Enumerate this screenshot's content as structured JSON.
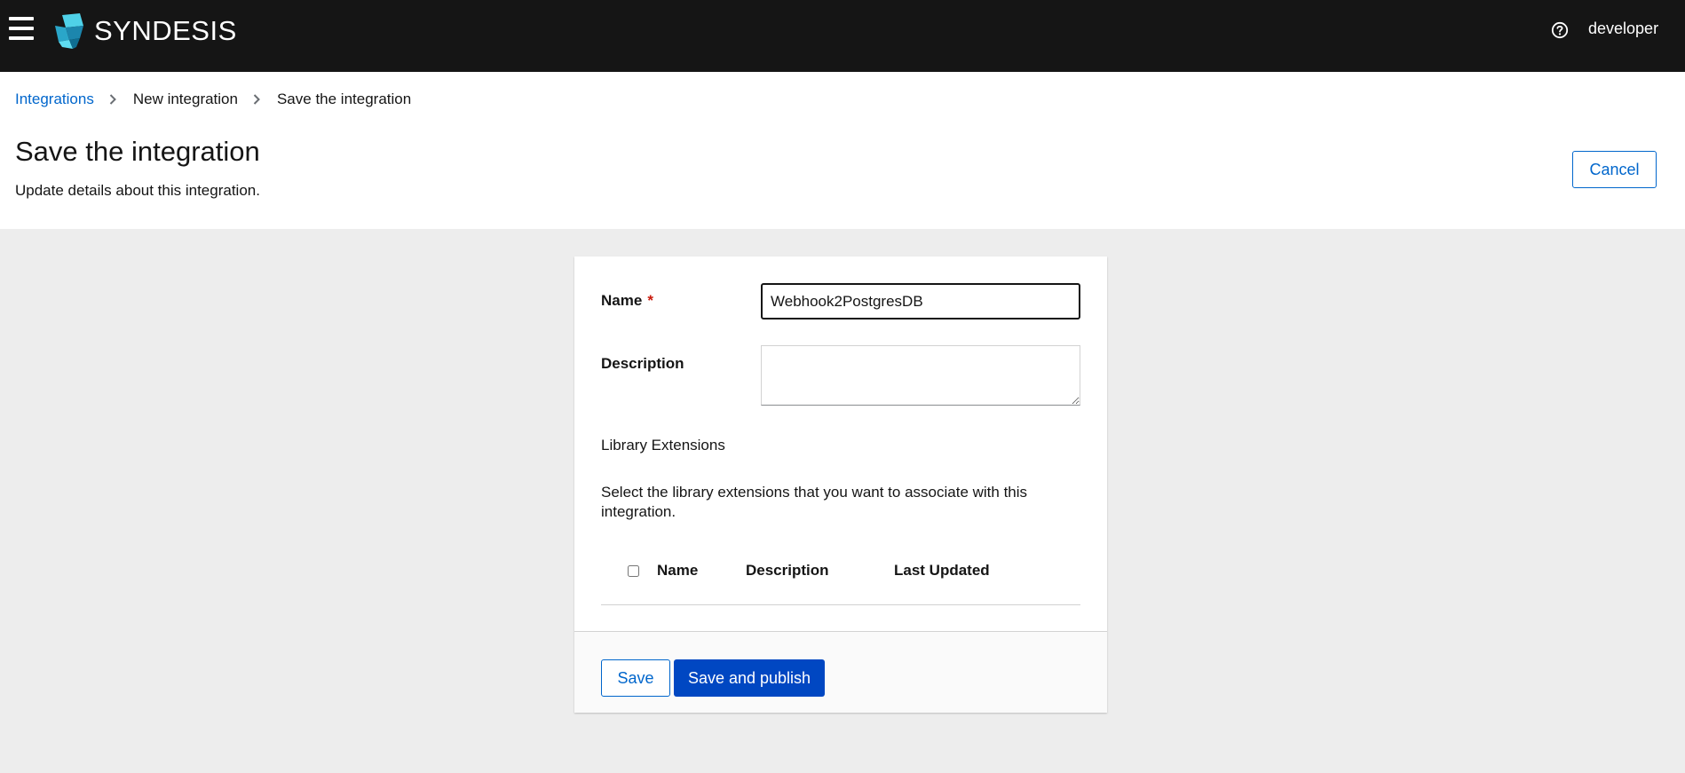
{
  "masthead": {
    "brand": "SYNDESIS",
    "user": "developer",
    "icons": {
      "menu": "hamburger-icon",
      "logo": "syndesis-logo-icon",
      "help": "help-circle-icon"
    }
  },
  "breadcrumb": {
    "items": [
      "Integrations",
      "New integration",
      "Save the integration"
    ]
  },
  "header": {
    "title": "Save the integration",
    "description": "Update details about this integration.",
    "cancel_label": "Cancel"
  },
  "form": {
    "name_label": "Name",
    "required_marker": "*",
    "name_value": "Webhook2PostgresDB",
    "description_label": "Description",
    "description_value": "",
    "library_heading": "Library Extensions",
    "library_help": "Select the library extensions that you want to associate with this integration.",
    "table_columns": [
      "Name",
      "Description",
      "Last Updated"
    ]
  },
  "footer": {
    "save_label": "Save",
    "publish_label": "Save and publish"
  },
  "colors": {
    "masthead": "#151515",
    "link": "#0066cc",
    "primary": "#0047c2",
    "required": "#c9190b",
    "background": "#ededed"
  }
}
